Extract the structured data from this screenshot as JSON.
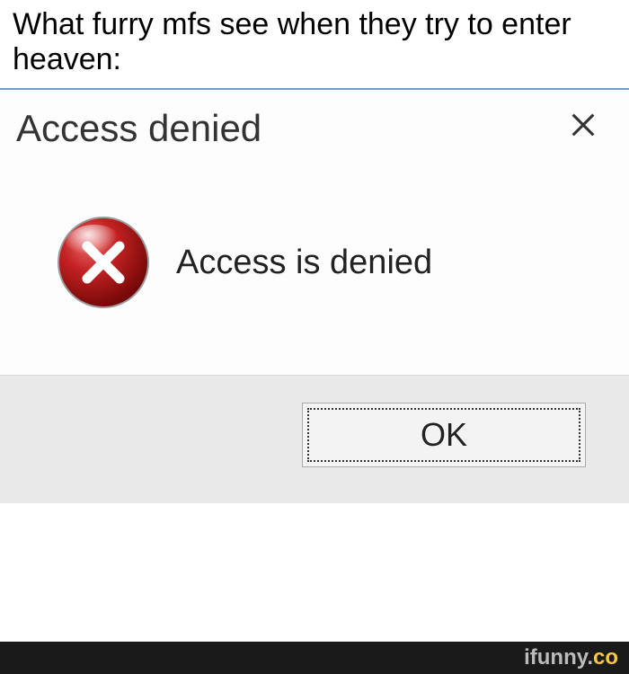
{
  "caption": "What furry mfs see when they try to enter heaven:",
  "dialog": {
    "title": "Access denied",
    "message": "Access is denied",
    "ok_label": "OK"
  },
  "watermark": {
    "brand_prefix": "ifunny.",
    "brand_suffix": "co"
  }
}
